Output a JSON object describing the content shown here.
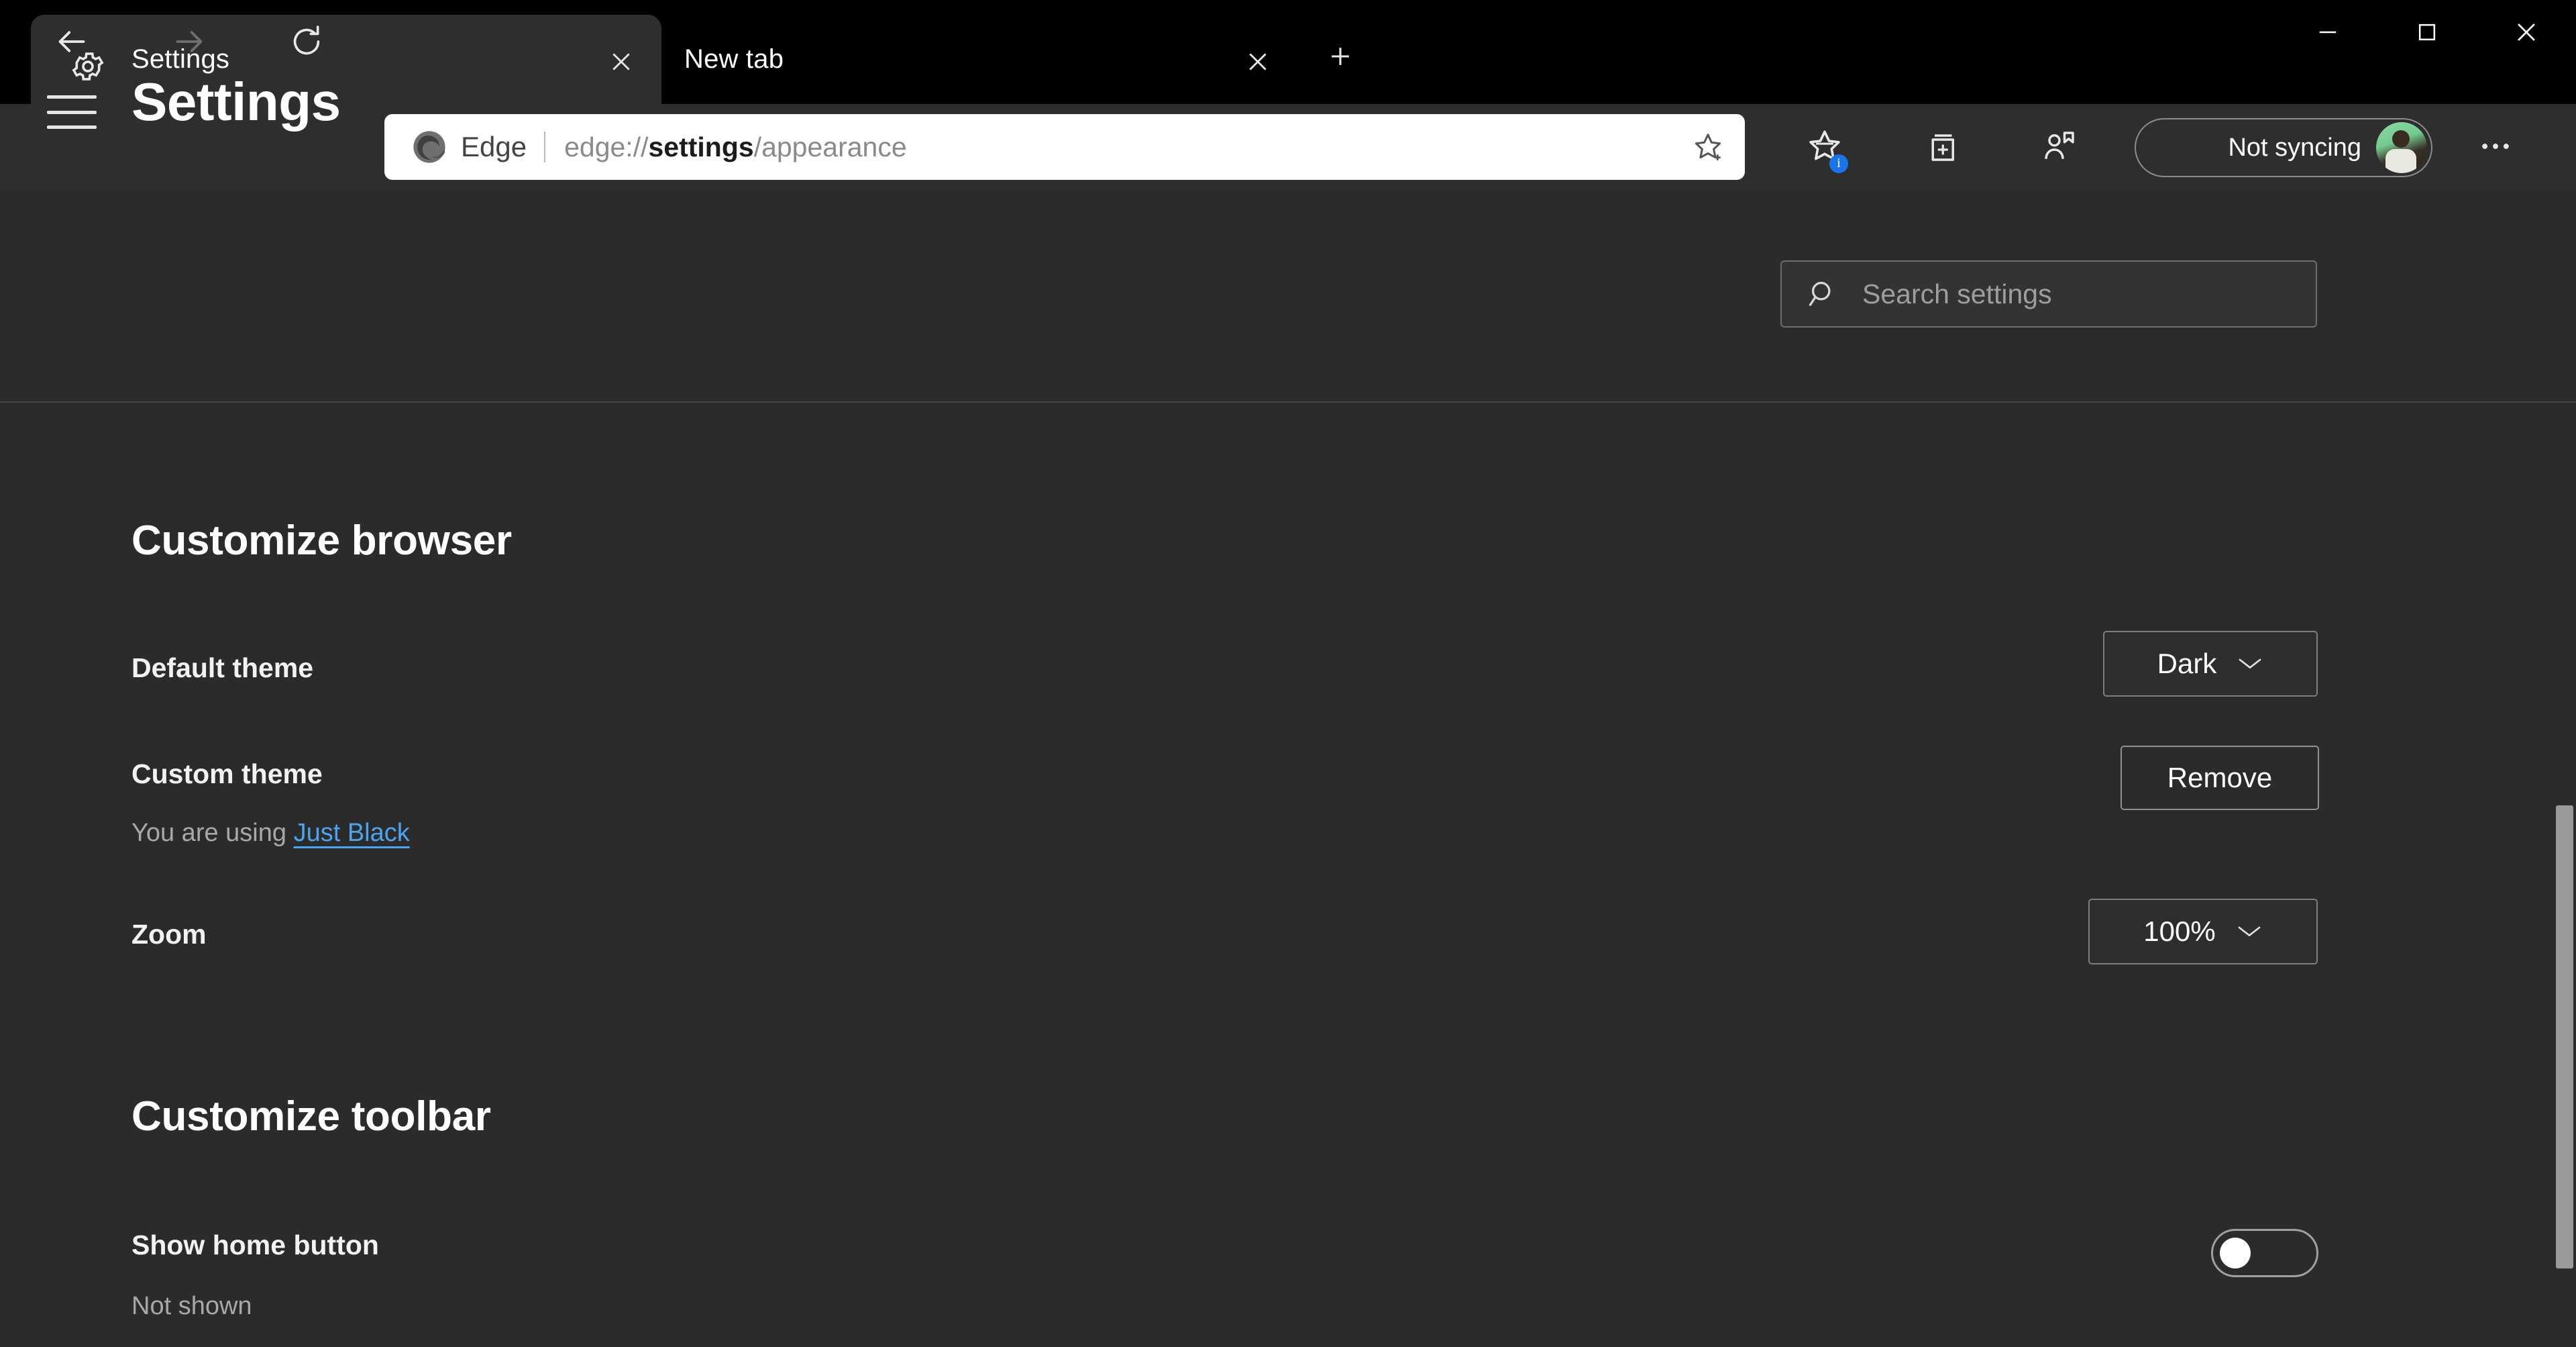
{
  "window": {
    "controls": [
      {
        "name": "minimize",
        "glyph": "minimize-icon"
      },
      {
        "name": "maximize",
        "glyph": "maximize-icon"
      },
      {
        "name": "close",
        "glyph": "close-icon"
      }
    ]
  },
  "tabs": [
    {
      "title": "Settings",
      "icon": "gear-icon",
      "active": true,
      "close_label": "Close tab"
    },
    {
      "title": "New tab",
      "icon": "none",
      "active": false,
      "close_label": "Close tab"
    }
  ],
  "newtab": {
    "label": "New tab",
    "icon": "plus-icon"
  },
  "toolbar": {
    "back": {
      "icon": "back-arrow-icon",
      "enabled": true
    },
    "forward": {
      "icon": "forward-arrow-icon",
      "enabled": false
    },
    "refresh": {
      "icon": "refresh-icon",
      "enabled": true
    },
    "address": {
      "brand": "Edge",
      "brand_icon": "edge-logo-icon",
      "url_dim_prefix": "edge://",
      "url_bold": "settings",
      "url_dim_suffix": "/appearance",
      "full_url": "edge://settings/appearance",
      "favorite_icon": "star-add-icon"
    },
    "icons": [
      {
        "name": "favorites-icon",
        "badge": "i"
      },
      {
        "name": "collections-icon",
        "badge": ""
      },
      {
        "name": "profile-add-icon",
        "badge": ""
      }
    ],
    "profile": {
      "label": "Not syncing",
      "avatar": "user-avatar"
    },
    "more": {
      "label": "Settings and more",
      "icon": "ellipsis-icon"
    }
  },
  "settings": {
    "menu_icon": "hamburger-menu-icon",
    "title": "Settings",
    "search": {
      "placeholder": "Search settings",
      "value": "",
      "icon": "search-icon"
    }
  },
  "sections": [
    {
      "heading": "Customize browser",
      "rows": [
        {
          "label": "Default theme",
          "sub": "",
          "control": {
            "type": "dropdown",
            "value": "Dark"
          }
        },
        {
          "label": "Custom theme",
          "sub_prefix": "You are using ",
          "sub_link": "Just Black",
          "control": {
            "type": "button",
            "value": "Remove"
          }
        },
        {
          "label": "Zoom",
          "sub": "",
          "control": {
            "type": "dropdown",
            "value": "100%"
          }
        }
      ]
    },
    {
      "heading": "Customize toolbar",
      "rows": [
        {
          "label": "Show home button",
          "sub": "Not shown",
          "control": {
            "type": "toggle",
            "value": "off"
          }
        }
      ]
    }
  ],
  "colors": {
    "tabstrip_bg": "#000000",
    "toolbar_bg": "#2e2e2e",
    "page_bg": "#2b2b2b",
    "accent_link": "#4da3f0",
    "badge_blue": "#1a73e8",
    "text_primary": "#ffffff",
    "text_secondary": "#a8a8a8"
  }
}
